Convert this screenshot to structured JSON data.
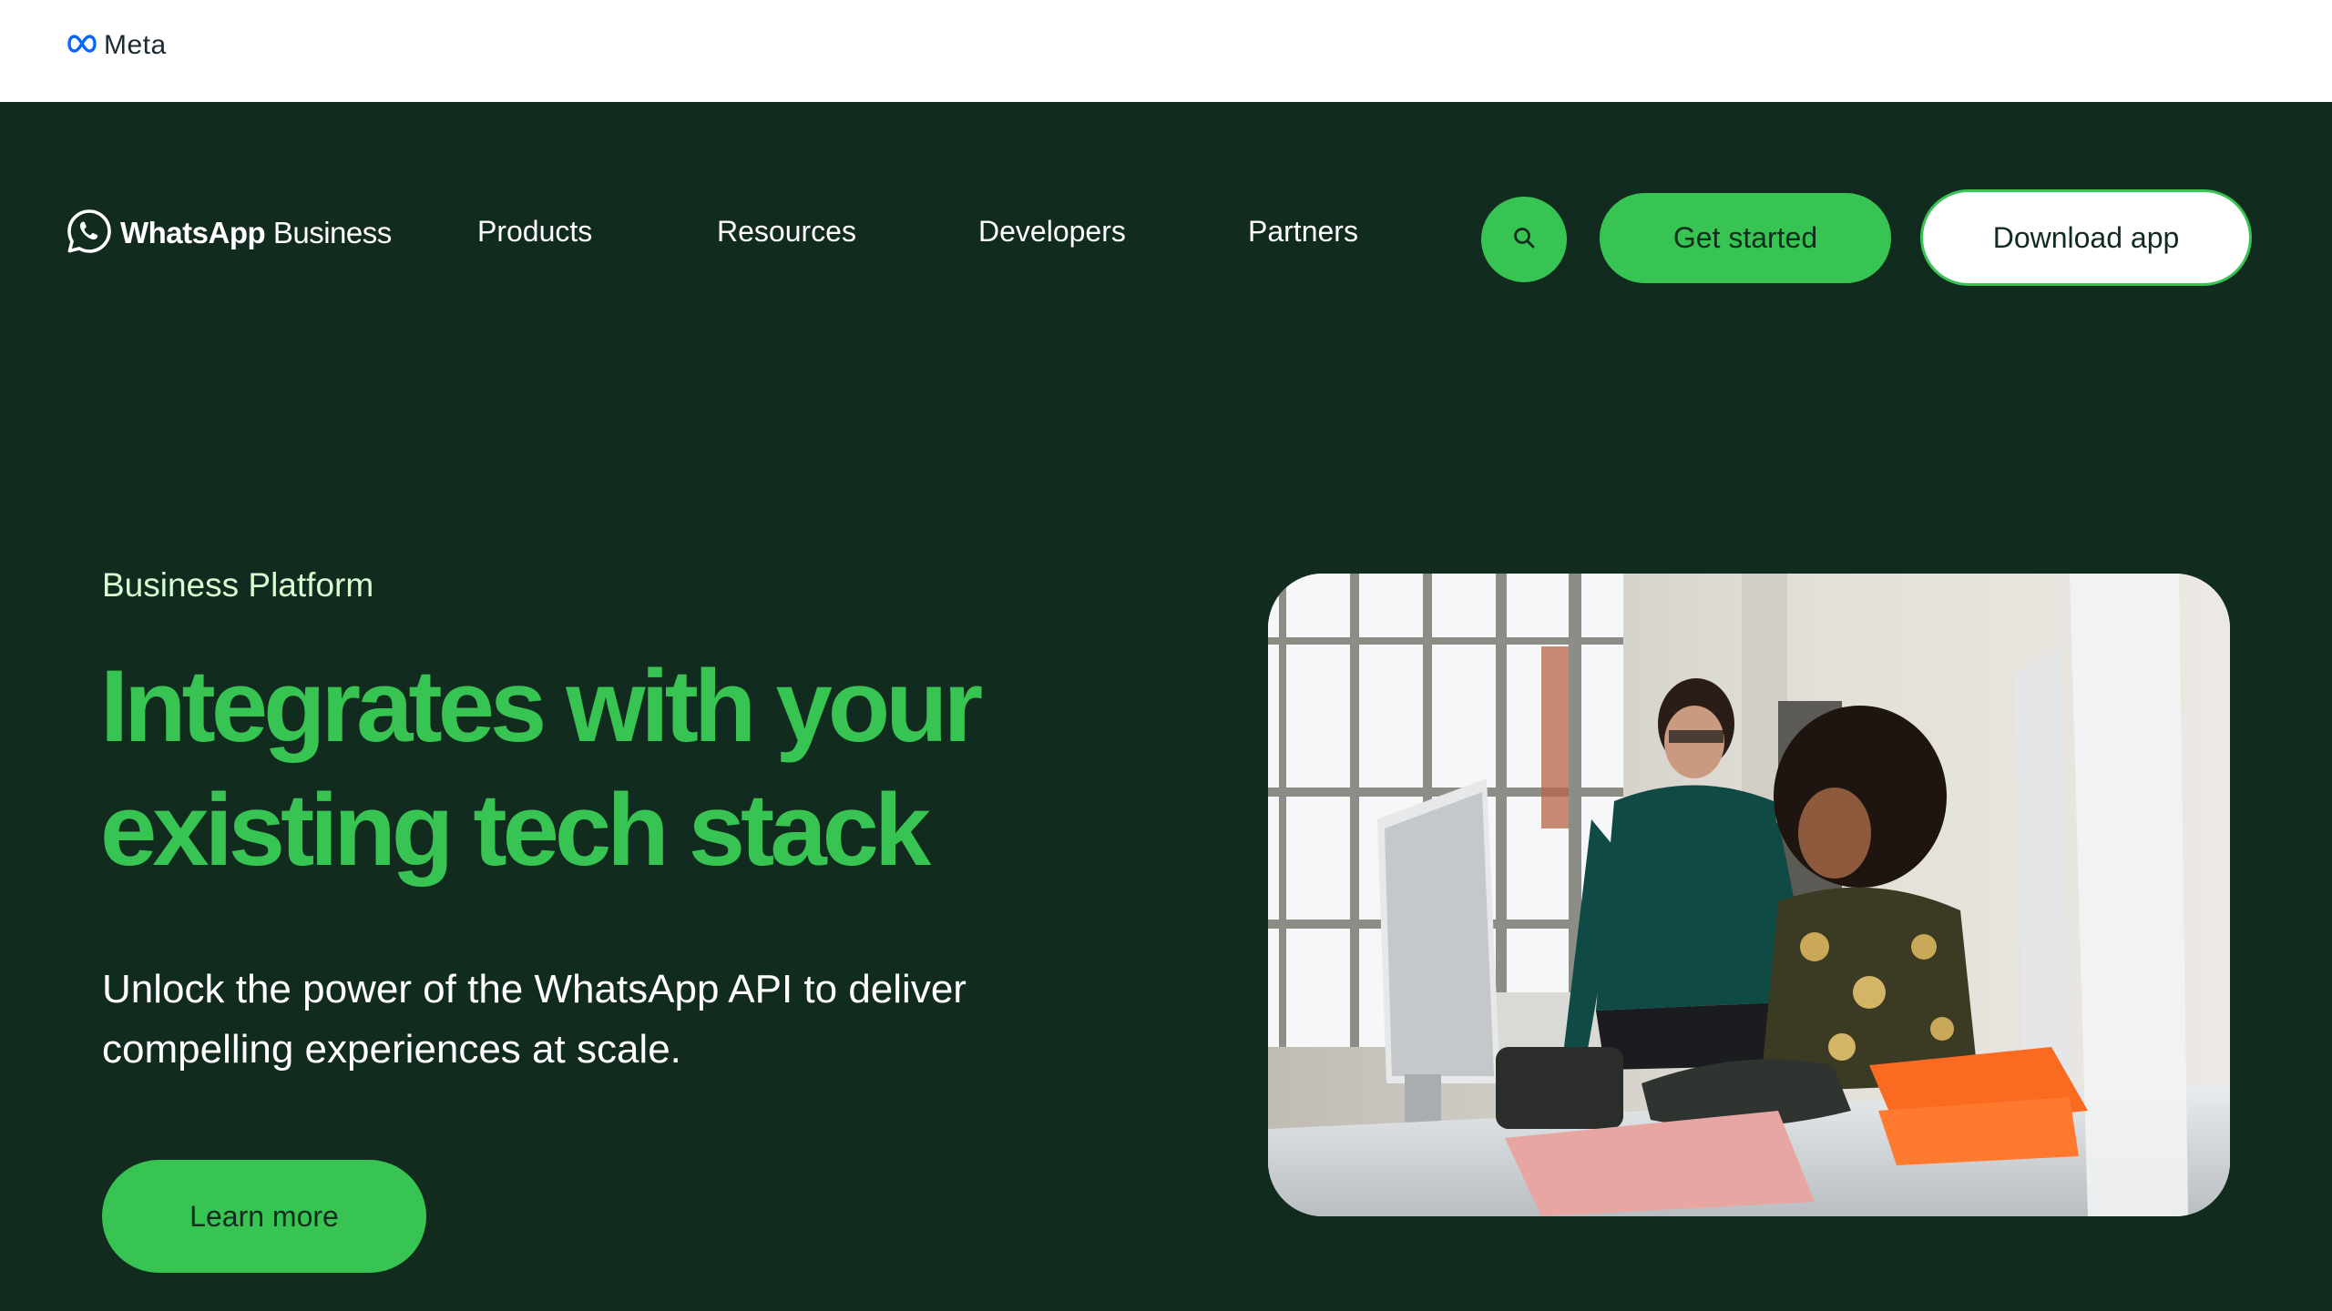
{
  "meta_header": {
    "logo_text": "Meta",
    "logo_icon": "meta-infinity-icon",
    "logo_color": "#0866ff"
  },
  "nav": {
    "brand_bold": "WhatsApp",
    "brand_light": " Business",
    "brand_icon": "whatsapp-phone-bubble-icon",
    "items": [
      {
        "label": "Products"
      },
      {
        "label": "Resources"
      },
      {
        "label": "Developers"
      },
      {
        "label": "Partners"
      }
    ],
    "search_icon": "search-icon",
    "get_started_label": "Get started",
    "download_label": "Download app"
  },
  "hero": {
    "eyebrow": "Business Platform",
    "headline_line1": "Integrates with your",
    "headline_line2": "existing tech stack",
    "subhead_line1": "Unlock the power of the WhatsApp API to deliver",
    "subhead_line2": "compelling experiences at scale.",
    "cta_label": "Learn more",
    "image_subject": "Two women working at a desk with computers in a bright office"
  },
  "colors": {
    "background_dark": "#112c1e",
    "accent_green": "#38c453",
    "eyebrow_green": "#d9fdd3",
    "white": "#ffffff"
  }
}
